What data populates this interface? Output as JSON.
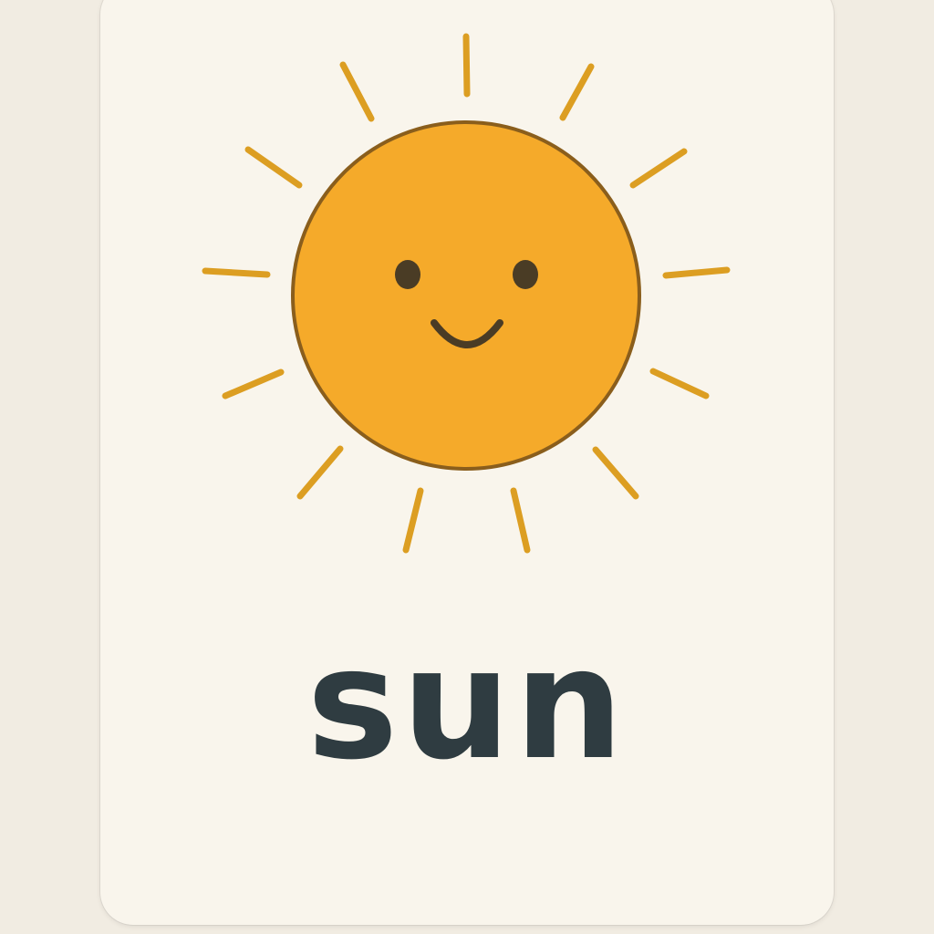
{
  "card": {
    "word": "sun",
    "illustration": "smiling-sun-icon"
  },
  "colors": {
    "page_background": "#f1ece2",
    "card_background": "#f9f5ec",
    "sun_fill": "#f5aa2a",
    "sun_outline": "#8a5e1c",
    "ray_color": "#dc9e22",
    "face_color": "#4a3c25",
    "word_color": "#2f3c41"
  }
}
